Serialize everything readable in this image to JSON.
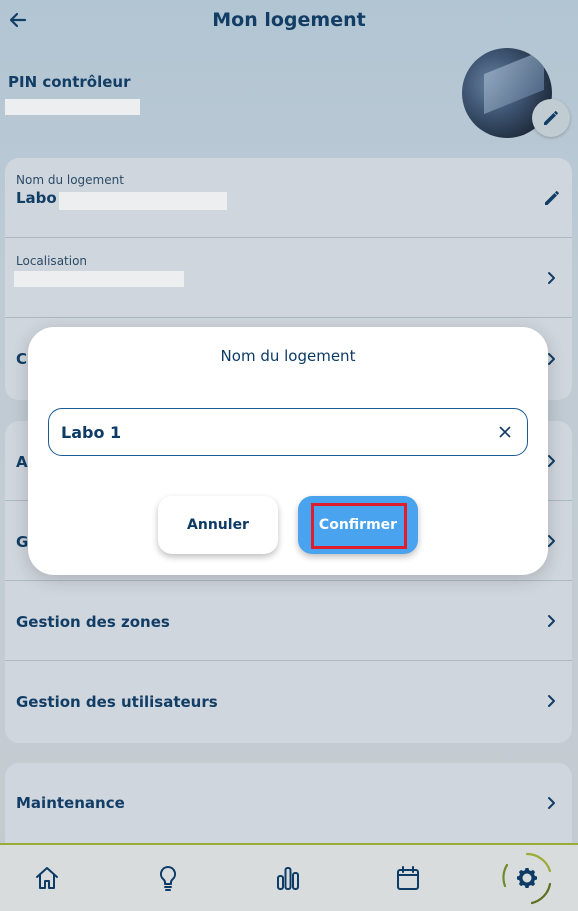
{
  "header": {
    "title": "Mon logement"
  },
  "pin": {
    "label": "PIN contrôleur"
  },
  "info_card": {
    "name_label": "Nom du logement",
    "name_value": "Labo",
    "location_label": "Localisation",
    "third_row_initial": "C"
  },
  "menu_card": {
    "row1_initial": "A",
    "row2_initial": "G",
    "zones": "Gestion des zones",
    "users": "Gestion des utilisateurs"
  },
  "maintenance": {
    "label": "Maintenance"
  },
  "dialog": {
    "title": "Nom du logement",
    "input_value": "Labo 1",
    "cancel_label": "Annuler",
    "confirm_label": "Confirmer"
  },
  "bottom_nav": {
    "items": [
      "home-icon",
      "bulb-icon",
      "stats-icon",
      "calendar-icon",
      "settings-icon"
    ],
    "active": "settings-icon"
  },
  "colors": {
    "primary": "#0d3b66",
    "accent": "#4aa3ee",
    "highlight": "#e01e2b",
    "nav_border": "#97ad35"
  }
}
